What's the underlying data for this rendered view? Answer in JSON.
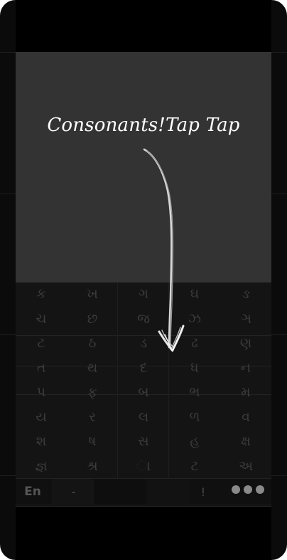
{
  "tutorial": {
    "title": "Consonants!Tap Tap"
  },
  "keyboard": {
    "keys": [
      "ક",
      "ખ",
      "ગ",
      "ઘ",
      "ઙ",
      "ચ",
      "છ",
      "જ",
      "ઝ",
      "ઞ",
      "ટ",
      "ઠ",
      "ડ",
      "ઢ",
      "ણ",
      "ત",
      "થ",
      "દ",
      "ધ",
      "ન",
      "પ",
      "ફ",
      "બ",
      "ભ",
      "મ",
      "ય",
      "ર",
      "લ",
      "ળ",
      "વ",
      "શ",
      "ષ",
      "સ",
      "હ",
      "ક્ષ",
      "જ્ઞ",
      "શ્ર",
      "ા",
      "ટ",
      "અ"
    ],
    "functions": {
      "lang": "En",
      "dash": "-",
      "space": "",
      "exclaim": "!"
    }
  },
  "colors": {
    "overlay": "#333333",
    "background": "#0b0b0b",
    "key_text": "#3b3b3b",
    "dots": "#8a8a8a"
  }
}
